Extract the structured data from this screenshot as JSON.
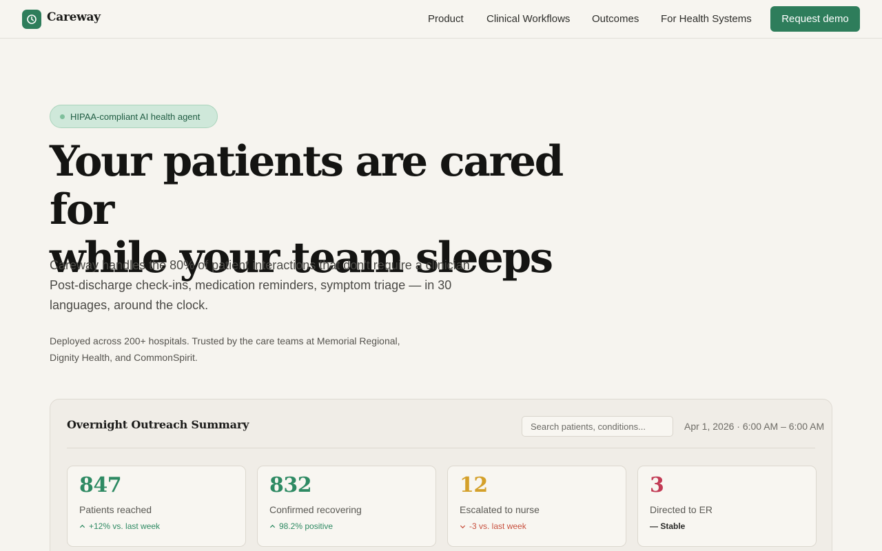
{
  "brand": {
    "name": "Careway",
    "accent": "#2e7d5b"
  },
  "nav": {
    "links": [
      "Product",
      "Clinical Workflows",
      "Outcomes",
      "For Health Systems"
    ],
    "cta": "Request demo"
  },
  "hero": {
    "badge": "HIPAA-compliant AI health agent",
    "title_line1": "Your patients are cared for",
    "title_line2": "while your team sleeps",
    "subtitle": "Careway handles the 80% of patient interactions that don't require a clinician. Post-discharge check-ins, medication reminders, symptom triage — in 30 languages, around the clock.",
    "trust": "Deployed across 200+ hospitals. Trusted by the care teams at Memorial Regional, Dignity Health, and CommonSpirit."
  },
  "summary": {
    "title": "Overnight Outreach Summary",
    "search_placeholder": "Search patients, conditions...",
    "date": "Apr 1, 2026 · 6:00 AM – 6:00 AM",
    "cards": [
      {
        "value": "847",
        "label": "Patients reached",
        "delta": "+12% vs. last week",
        "trend": "up",
        "value_color": "#2e8a63",
        "delta_color": "#2e8a63"
      },
      {
        "value": "832",
        "label": "Confirmed recovering",
        "delta": "98.2% positive",
        "trend": "up",
        "value_color": "#2e8a63",
        "delta_color": "#2e8a63"
      },
      {
        "value": "12",
        "label": "Escalated to nurse",
        "delta": "-3 vs. last week",
        "trend": "down",
        "value_color": "#d4a02a",
        "delta_color": "#c8503e"
      },
      {
        "value": "3",
        "label": "Directed to ER",
        "delta": "— Stable",
        "trend": "flat",
        "value_color": "#c23b55",
        "delta_color": "#2a2a28"
      }
    ]
  }
}
